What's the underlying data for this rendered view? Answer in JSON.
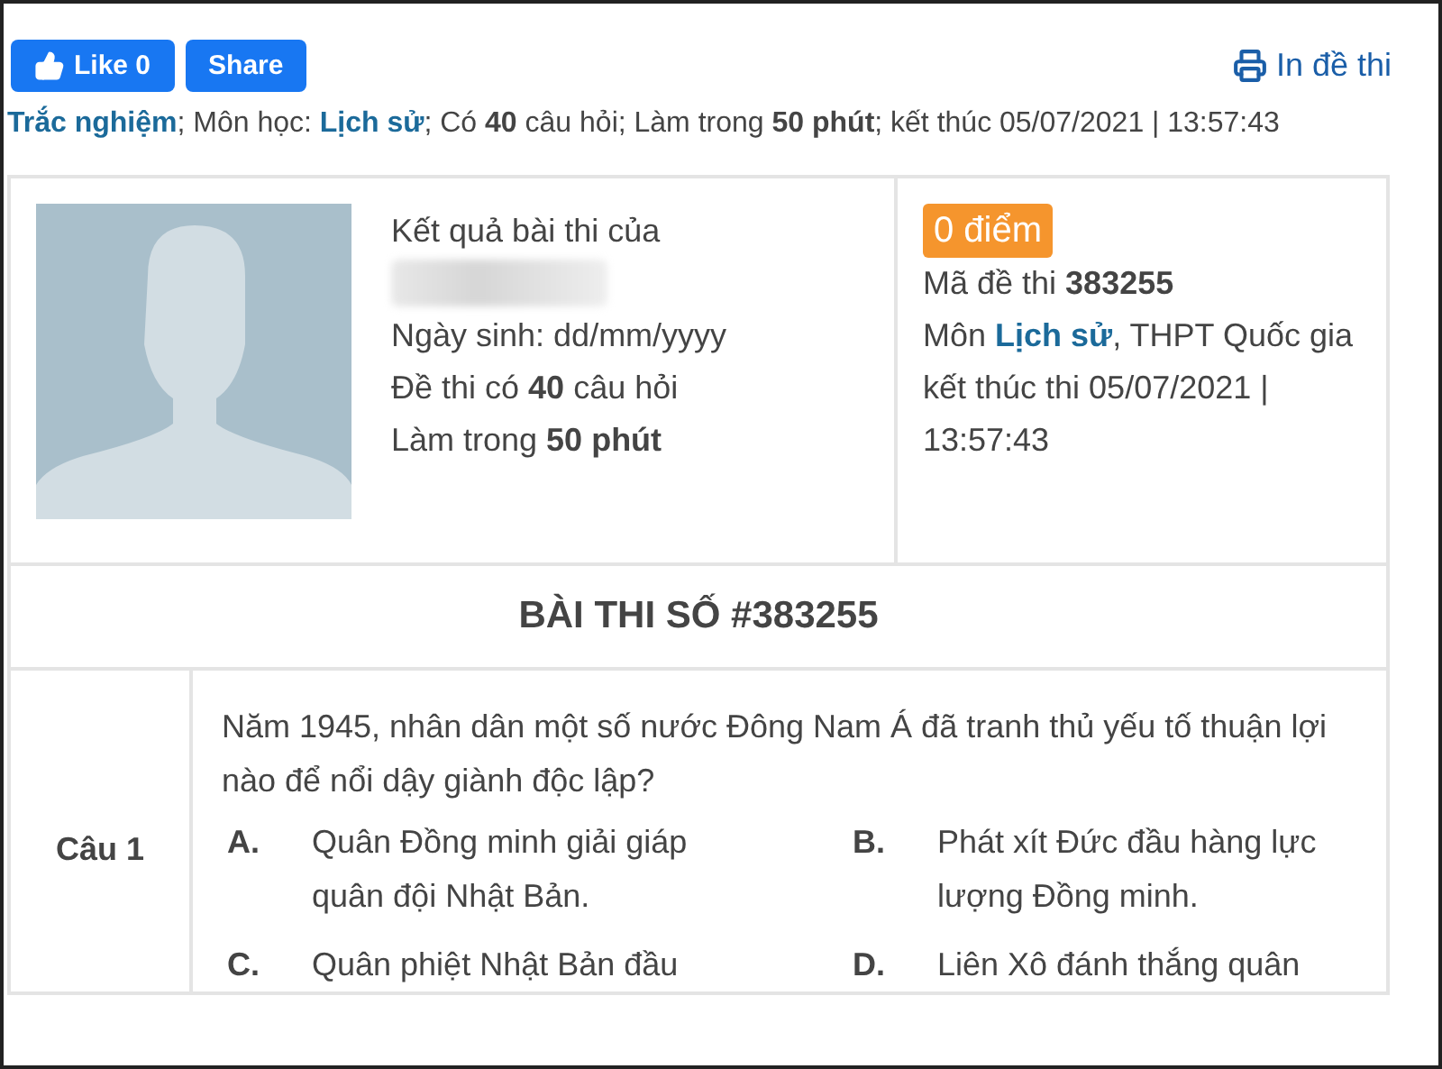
{
  "social_buttons": [
    {
      "kind": "like",
      "label": "Like 0"
    },
    {
      "kind": "share",
      "label": "Share"
    }
  ],
  "print_link": "In đề thi",
  "exam_meta": [
    {
      "kind": "link",
      "text": "Trắc nghiệm"
    },
    {
      "kind": "plain",
      "text": "; Môn học: "
    },
    {
      "kind": "link",
      "text": "Lịch sử"
    },
    {
      "kind": "plain",
      "text": "; Có "
    },
    {
      "kind": "bold",
      "text": "40"
    },
    {
      "kind": "plain",
      "text": " câu hỏi; Làm trong "
    },
    {
      "kind": "bold",
      "text": "50 phút"
    },
    {
      "kind": "plain",
      "text": "; kết thúc 05/07/2021 | 13:57:43"
    }
  ],
  "result_card": {
    "heading": "Kết quả bài thi của",
    "details": [
      [
        {
          "kind": "plain",
          "text": "Ngày sinh: dd/mm/yyyy"
        }
      ],
      [
        {
          "kind": "plain",
          "text": "Đề thi có "
        },
        {
          "kind": "bold",
          "text": "40"
        },
        {
          "kind": "plain",
          "text": " câu hỏi"
        }
      ],
      [
        {
          "kind": "plain",
          "text": "Làm trong "
        },
        {
          "kind": "bold",
          "text": "50 phút"
        }
      ]
    ],
    "score": "0 điểm",
    "exam_info": [
      [
        {
          "kind": "plain",
          "text": "Mã đề thi "
        },
        {
          "kind": "bold",
          "text": "383255"
        }
      ],
      [
        {
          "kind": "plain",
          "text": "Môn "
        },
        {
          "kind": "link",
          "text": "Lịch sử"
        },
        {
          "kind": "plain",
          "text": ", THPT Quốc gia"
        }
      ],
      [
        {
          "kind": "plain",
          "text": "kết thúc thi 05/07/2021 | 13:57:43"
        }
      ]
    ]
  },
  "exam_title": "BÀI THI SỐ #383255",
  "questions": [
    {
      "label": "Câu 1",
      "text": "Năm 1945, nhân dân một số nước Đông Nam Á đã tranh thủ yếu tố thuận lợi nào để nổi dậy giành độc lập?",
      "options": [
        {
          "letter": "A.",
          "text": "Quân Đồng minh giải giáp quân đội Nhật Bản."
        },
        {
          "letter": "B.",
          "text": "Phát xít Đức đầu hàng lực lượng Đồng minh."
        },
        {
          "letter": "C.",
          "text": "Quân phiệt Nhật Bản đầu"
        },
        {
          "letter": "D.",
          "text": "Liên Xô đánh thắng quân"
        }
      ]
    }
  ]
}
